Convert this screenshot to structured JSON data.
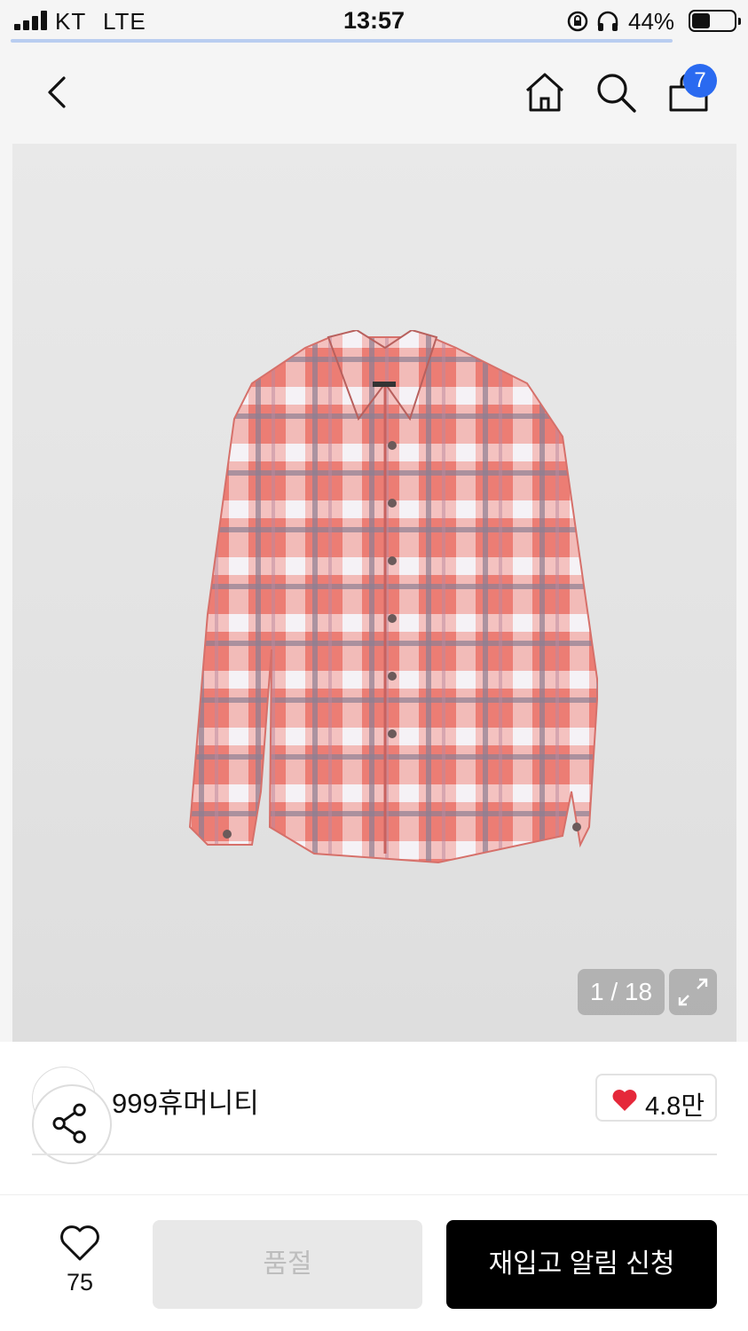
{
  "status_bar": {
    "carrier": "KT",
    "network": "LTE",
    "time": "13:57",
    "battery": "44%",
    "battery_level": 0.44,
    "icons": [
      "signal-icon",
      "rotation-lock-icon",
      "headphones-icon",
      "battery-icon"
    ]
  },
  "nav": {
    "icons": [
      "back-icon",
      "home-icon",
      "search-icon",
      "cart-icon"
    ],
    "cart_count": "7"
  },
  "gallery": {
    "counter": "1 / 18",
    "expand_icon": "expand-icon",
    "product_image": "pink plaid long-sleeve shirt"
  },
  "brand": {
    "name": "999휴머니티",
    "likes": "4.8만",
    "like_icon": "heart-icon",
    "share_icon": "share-icon"
  },
  "bottom_bar": {
    "wishlist_count": "75",
    "soldout_label": "품절",
    "restock_label": "재입고 알림 신청"
  },
  "colors": {
    "accent": "#2a6af0",
    "heart": "#e5283a",
    "primary_button": "#000000",
    "disabled_button": "#e8e8e8"
  }
}
